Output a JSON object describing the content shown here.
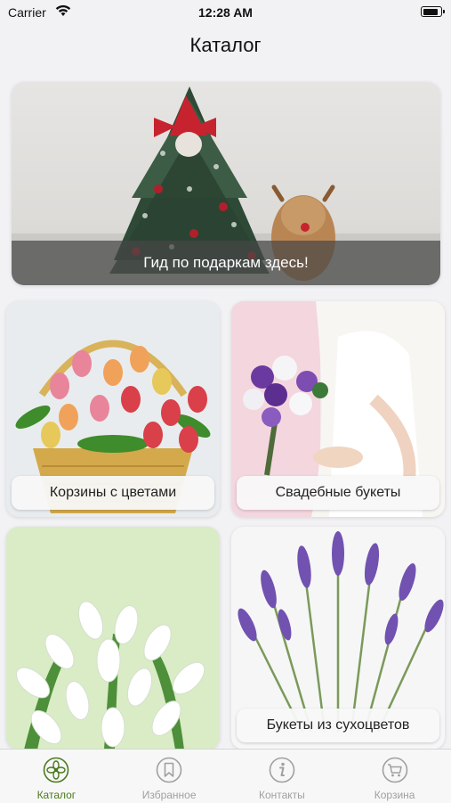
{
  "status_bar": {
    "carrier": "Carrier",
    "time": "12:28 AM",
    "battery_level": 0.9
  },
  "nav": {
    "title": "Каталог"
  },
  "banner": {
    "caption": "Гид по подаркам здесь!"
  },
  "categories": [
    {
      "label": "Корзины с цветами"
    },
    {
      "label": "Свадебные букеты"
    },
    {
      "label": ""
    },
    {
      "label": "Букеты из сухоцветов"
    }
  ],
  "tabs": [
    {
      "label": "Каталог",
      "icon": "flower-icon",
      "active": true
    },
    {
      "label": "Избранное",
      "icon": "bookmark-icon",
      "active": false
    },
    {
      "label": "Контакты",
      "icon": "info-icon",
      "active": false
    },
    {
      "label": "Корзина",
      "icon": "cart-icon",
      "active": false
    }
  ],
  "colors": {
    "accent": "#4a7a1e",
    "inactive": "#a0a0a0"
  }
}
